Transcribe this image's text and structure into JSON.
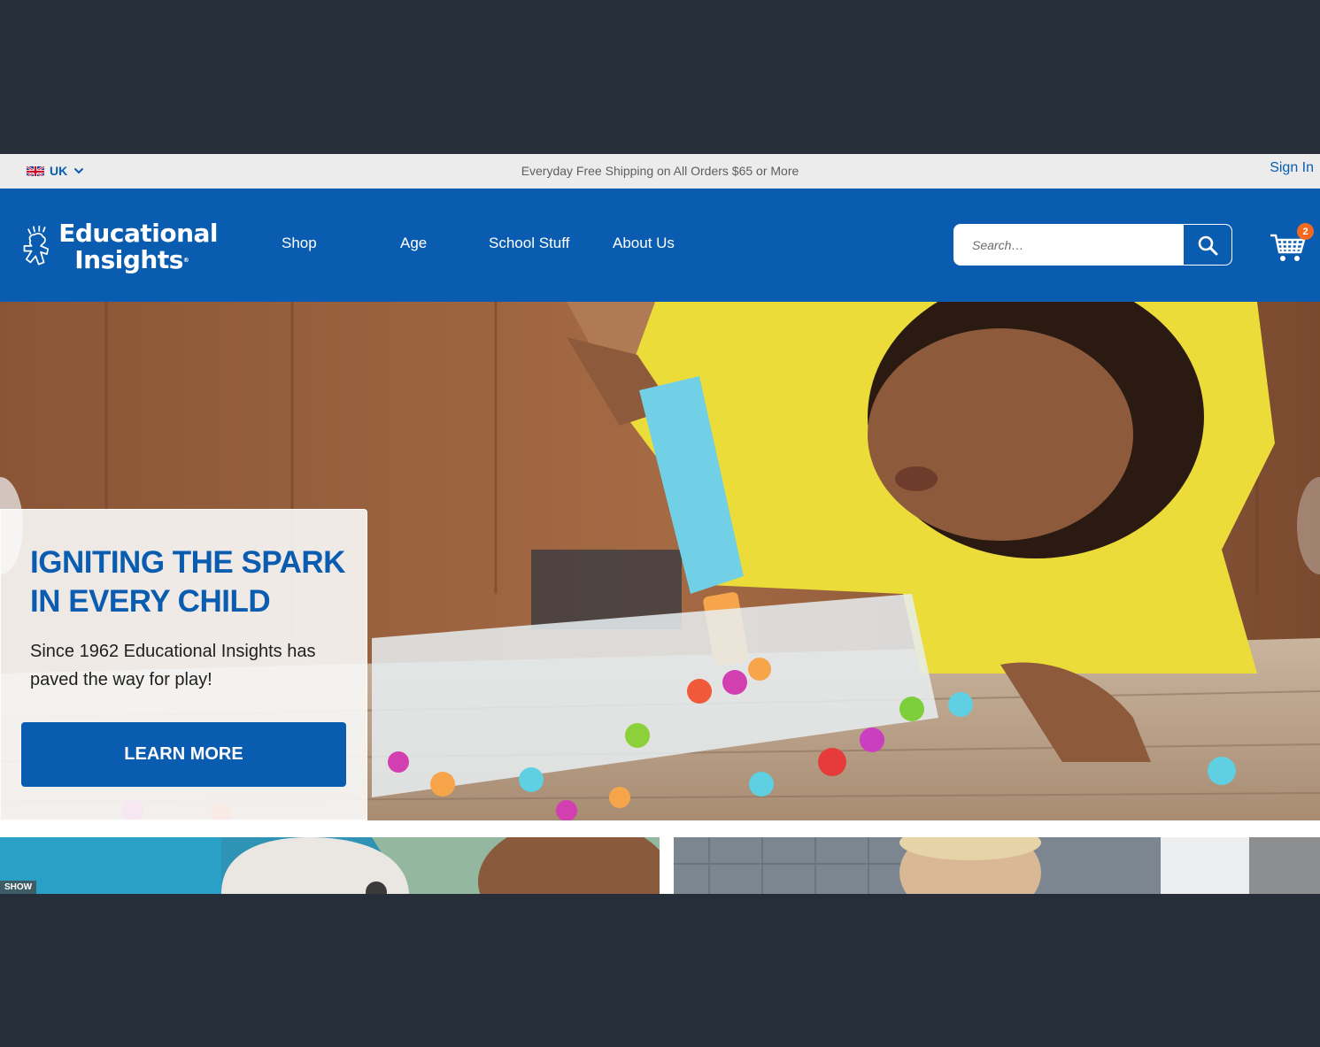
{
  "topbar": {
    "locale_label": "UK",
    "promo_text": "Everyday Free Shipping on All Orders $65 or More",
    "sign_in_label": "Sign In"
  },
  "header": {
    "logo_line1": "Educational",
    "logo_line2": "Insights",
    "logo_tm": "®",
    "nav": [
      "Shop",
      "Age",
      "School Stuff",
      "About Us"
    ],
    "search_placeholder": "Search…",
    "cart_count": "2"
  },
  "hero": {
    "title": "IGNITING THE SPARK IN EVERY CHILD",
    "subtitle": "Since 1962 Educational Insights has paved the way for play!",
    "cta_label": "LEARN MORE"
  },
  "tiles": {
    "left_tag": "SHOW"
  },
  "colors": {
    "brand_blue": "#0a5cb0",
    "badge_orange": "#f26a21",
    "topbar_bg": "#ececec",
    "outer_bg": "#262e39"
  },
  "icons": [
    "uk-flag-icon",
    "chevron-down-icon",
    "search-icon",
    "cart-icon",
    "logo-kid-icon"
  ]
}
